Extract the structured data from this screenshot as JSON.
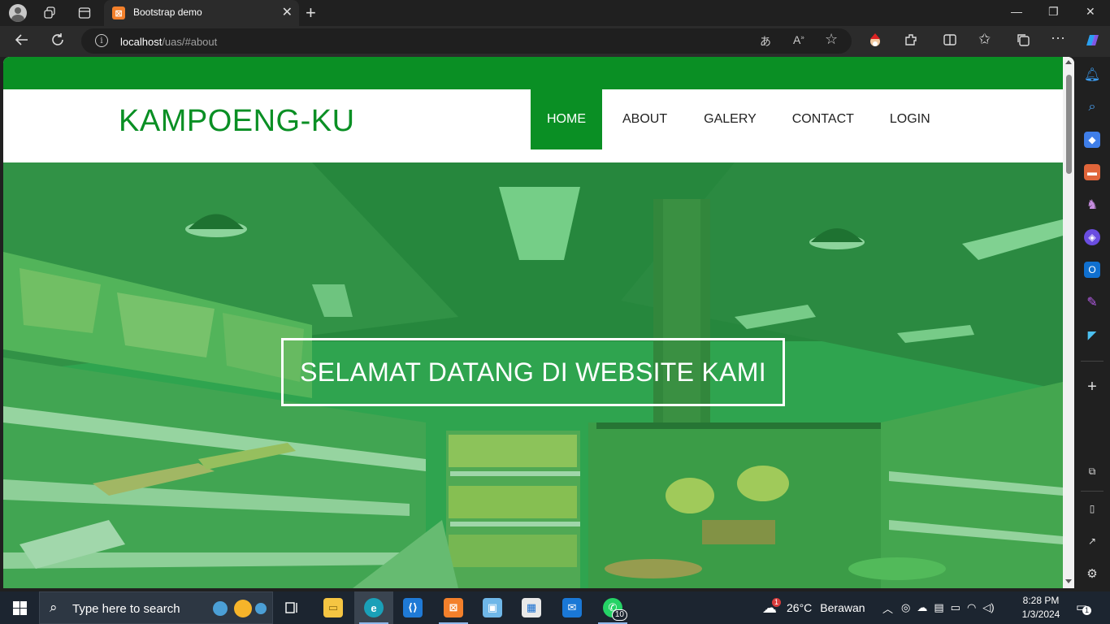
{
  "browser": {
    "tab_title": "Bootstrap demo",
    "url_host": "localhost",
    "url_path": "/uas/#about"
  },
  "site": {
    "brand": "KAMPOENG-KU",
    "nav": [
      {
        "label": "HOME",
        "active": true
      },
      {
        "label": "ABOUT",
        "active": false
      },
      {
        "label": "GALERY",
        "active": false
      },
      {
        "label": "CONTACT",
        "active": false
      },
      {
        "label": "LOGIN",
        "active": false
      }
    ],
    "hero_title": "SELAMAT DATANG DI WEBSITE KAMI",
    "colors": {
      "primary": "#0a8f24",
      "hero_overlay": "#2fa34e"
    }
  },
  "taskbar": {
    "search_placeholder": "Type here to search",
    "weather_temp": "26°C",
    "weather_text": "Berawan",
    "weather_badge": "1",
    "time": "8:28 PM",
    "date": "1/3/2024",
    "whatsapp_badge": "10",
    "notification_badge": "1"
  }
}
